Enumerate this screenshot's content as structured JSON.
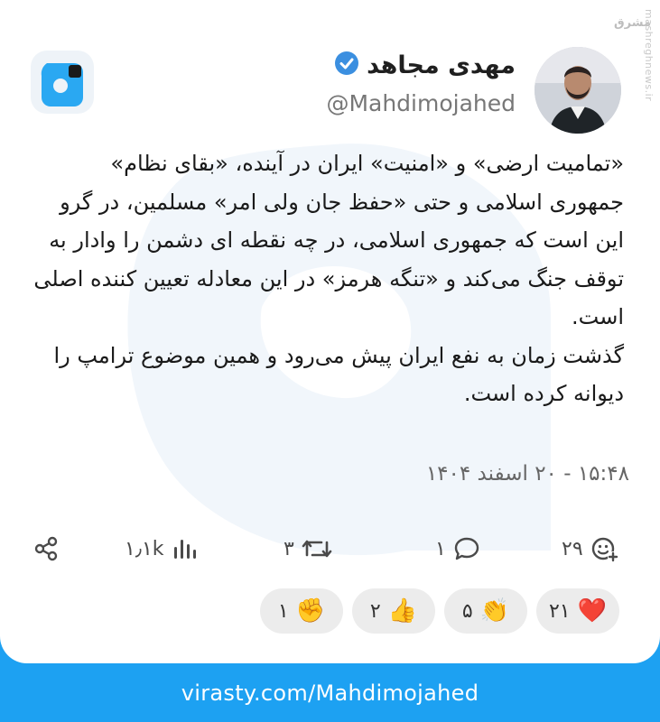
{
  "site_watermark": {
    "text": "mashreghnews.ir",
    "logo_text": "مشرق"
  },
  "author": {
    "name": "مهدی مجاهد",
    "handle": "@Mahdimojahed",
    "verified": true
  },
  "post": {
    "paragraphs": [
      "«تمامیت ارضی» و «امنیت» ایران در آینده، «بقای نظام» جمهوری اسلامی و حتی «حفظ جان ولی امر» مسلمین، در گرو این است که جمهوری اسلامی، در چه نقطه ای دشمن را وادار به توقف جنگ می‌کند و «تنگه هرمز» در این معادله تعیین کننده اصلی است.",
      "گذشت زمان به نفع ایران پیش می‌رود و همین موضوع ترامپ را دیوانه کرده است."
    ],
    "timestamp": "۱۵:۴۸ - ۲۰ اسفند ۱۴۰۴"
  },
  "actions": {
    "reactions_count": "۲۹",
    "replies_count": "۱",
    "reposts_count": "۳",
    "views_count": "۱٫۱k"
  },
  "reactions": [
    {
      "emoji": "❤️",
      "count": "۲۱"
    },
    {
      "emoji": "👏",
      "count": "۵"
    },
    {
      "emoji": "👍",
      "count": "۲"
    },
    {
      "emoji": "✊",
      "count": "۱"
    }
  ],
  "footer": {
    "url": "virasty.com/Mahdimojahed"
  },
  "colors": {
    "brand": "#1da1f2",
    "verified": "#3b8fe0"
  }
}
